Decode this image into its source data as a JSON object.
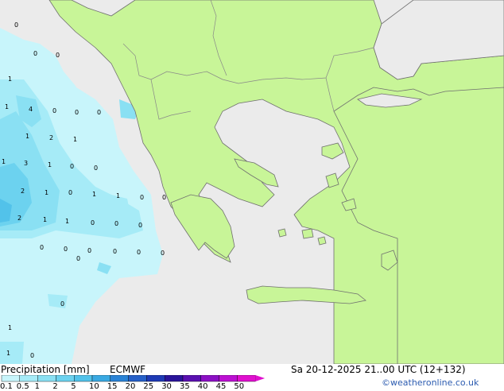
{
  "legend": {
    "title": "Precipitation [mm]",
    "model": "ECMWF",
    "ticks": [
      "0.1",
      "0.5",
      "1",
      "2",
      "5",
      "10",
      "15",
      "20",
      "25",
      "30",
      "35",
      "40",
      "45",
      "50"
    ],
    "colors": [
      "#c8f5fb",
      "#a6ebf7",
      "#8ae0f3",
      "#6cd2ef",
      "#52c2ea",
      "#3aa9e2",
      "#2a83d6",
      "#2660c8",
      "#1e3ab5",
      "#2a149a",
      "#5a10b0",
      "#8c10c4",
      "#bc10d2",
      "#e010cf"
    ]
  },
  "run": {
    "datetime": "Sa 20-12-2025 21..00 UTC (12+132)"
  },
  "credit": "©weatheronline.co.uk",
  "colors": {
    "sea": "#ebebeb",
    "land": "#c8f598",
    "border": "#888888",
    "coast": "#6f6f6f",
    "precip_light": "#c8f5fb",
    "precip_mid": "#8ae0f3",
    "precip_heavy": "#52c2ea"
  },
  "station_values": [
    "0",
    "0",
    "0",
    "1",
    "1",
    "4",
    "0",
    "0",
    "0",
    "1",
    "2",
    "1",
    "1",
    "3",
    "1",
    "0",
    "0",
    "2",
    "1",
    "0",
    "1",
    "1",
    "0",
    "0",
    "2",
    "1",
    "1",
    "0",
    "0",
    "0",
    "0",
    "0",
    "0",
    "0",
    "0",
    "0",
    "0",
    "0",
    "1",
    "1",
    "0"
  ]
}
